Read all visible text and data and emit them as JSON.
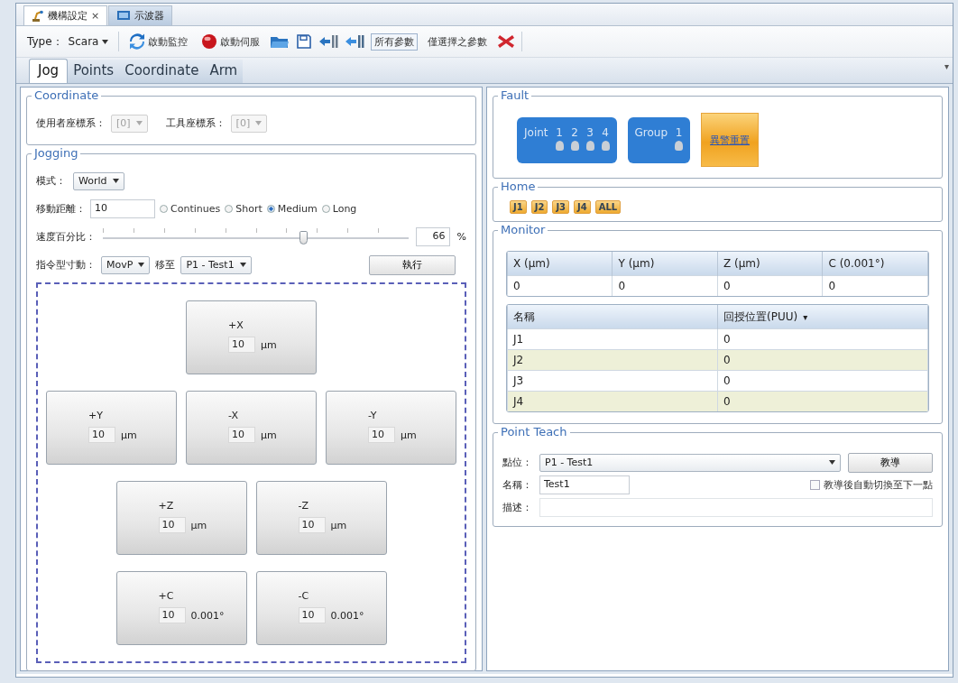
{
  "document_tabs": [
    {
      "label": "機構設定",
      "selected": true,
      "close_glyph": "×"
    },
    {
      "label": "示波器",
      "selected": false
    }
  ],
  "toolbar": {
    "type_label": "Type：",
    "type_value": "Scara",
    "items": [
      {
        "kind": "sync",
        "label": "啟動監控"
      },
      {
        "kind": "power",
        "label": "啟動伺服"
      },
      {
        "kind": "open"
      },
      {
        "kind": "save"
      },
      {
        "kind": "import"
      },
      {
        "kind": "export"
      },
      {
        "kind": "toggle",
        "label": "所有參數",
        "selected": true
      },
      {
        "kind": "toggle",
        "label": "僅選擇之參數",
        "selected": false
      },
      {
        "kind": "delete"
      }
    ]
  },
  "view_tabs": [
    {
      "label": "Jog",
      "selected": true
    },
    {
      "label": "Points",
      "selected": false
    },
    {
      "label": "Coordinate",
      "selected": false
    },
    {
      "label": "Arm",
      "selected": false
    }
  ],
  "view_tabs_glyph": "▾",
  "coordinate": {
    "title": "Coordinate",
    "fields": [
      {
        "label": "使用者座標系：",
        "value": "[0]",
        "disabled": true
      },
      {
        "label": "工具座標系：",
        "value": "[0]",
        "disabled": true
      }
    ]
  },
  "jogging": {
    "title": "Jogging",
    "mode": {
      "label": "模式：",
      "value": "World"
    },
    "distance": {
      "label": "移動距離：",
      "value": "10",
      "options": [
        {
          "label": "Continues",
          "selected": false
        },
        {
          "label": "Short",
          "selected": false
        },
        {
          "label": "Medium",
          "selected": true
        },
        {
          "label": "Long",
          "selected": false
        }
      ]
    },
    "speed": {
      "label": "速度百分比：",
      "level": 0.66,
      "reading": "66",
      "unit": "%"
    },
    "command": {
      "label": "指令型寸動：",
      "type": "MovP",
      "target_label": "移至",
      "target": "P1 - Test1",
      "button": "執行"
    },
    "jog_rows": [
      [
        {
          "label": "+X",
          "value": "10",
          "unit": "μm"
        }
      ],
      [
        {
          "label": "+Y",
          "value": "10",
          "unit": "μm"
        },
        {
          "label": "-X",
          "value": "10",
          "unit": "μm"
        },
        {
          "label": "-Y",
          "value": "10",
          "unit": "μm"
        }
      ],
      [
        {
          "label": "+Z",
          "value": "10",
          "unit": "μm"
        },
        {
          "label": "-Z",
          "value": "10",
          "unit": "μm"
        }
      ],
      [
        {
          "label": "+C",
          "value": "10",
          "unit": "0.001°"
        },
        {
          "label": "-C",
          "value": "10",
          "unit": "0.001°"
        }
      ]
    ]
  },
  "fault": {
    "title": "Fault",
    "groups": [
      {
        "label": "Joint",
        "channels": [
          {
            "label": "1",
            "on": false
          },
          {
            "label": "2",
            "on": false
          },
          {
            "label": "3",
            "on": false
          },
          {
            "label": "4",
            "on": false
          }
        ]
      },
      {
        "label": "Group",
        "channels": [
          {
            "label": "1",
            "on": false
          }
        ]
      }
    ],
    "reset_button": "異警重置"
  },
  "home": {
    "title": "Home",
    "buttons": [
      "J1",
      "J2",
      "J3",
      "J4",
      "ALL"
    ]
  },
  "monitor": {
    "title": "Monitor",
    "position_table": {
      "columns": [
        "X (μm)",
        "Y (μm)",
        "Z (μm)",
        "C (0.001°)"
      ],
      "rows": [
        [
          "0",
          "0",
          "0",
          "0"
        ]
      ]
    },
    "joint_table": {
      "columns": [
        "名稱",
        "回授位置(PUU)"
      ],
      "sort_glyph": "▾",
      "rows": [
        [
          "J1",
          "0"
        ],
        [
          "J2",
          "0"
        ],
        [
          "J3",
          "0"
        ],
        [
          "J4",
          "0"
        ]
      ]
    }
  },
  "point_teach": {
    "title": "Point Teach",
    "point": {
      "label": "點位：",
      "value": "P1 - Test1"
    },
    "teach_button": "教導",
    "name": {
      "label": "名稱：",
      "value": "Test1"
    },
    "auto_next": {
      "label": "教導後自動切換至下一點",
      "checked": false
    },
    "description": {
      "label": "描述："
    }
  }
}
